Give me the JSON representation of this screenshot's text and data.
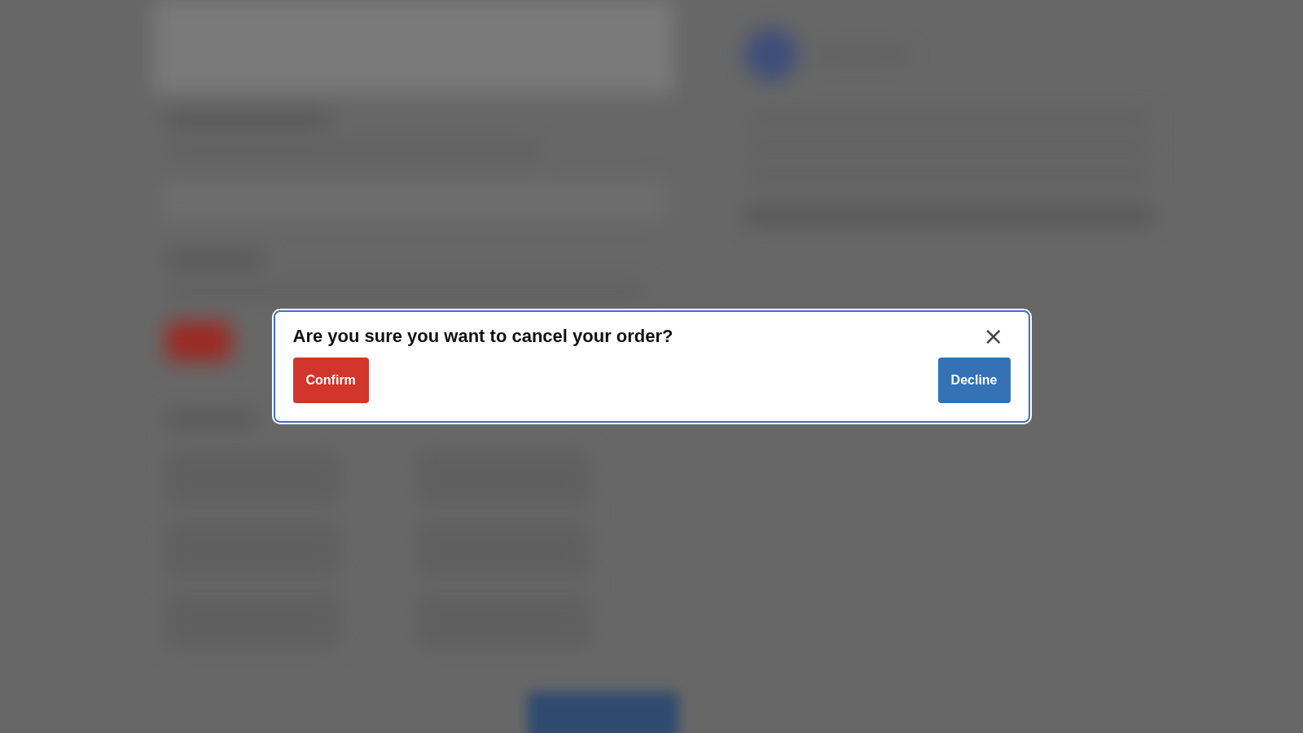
{
  "dialog": {
    "title": "Are you sure you want to cancel your order?",
    "close_label": "×",
    "buttons": [
      {
        "label": "Confirm",
        "kind": "danger"
      },
      {
        "label": "Decline",
        "kind": "primary"
      }
    ]
  }
}
